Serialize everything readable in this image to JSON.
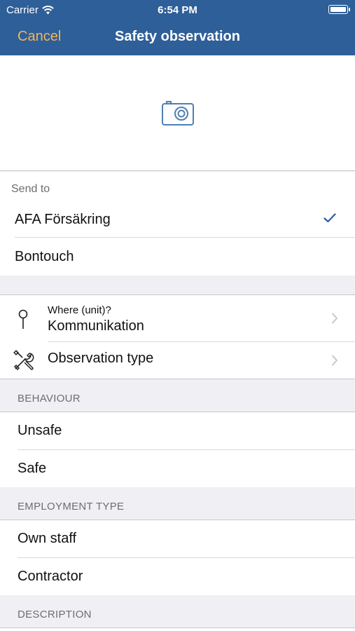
{
  "status": {
    "carrier": "Carrier",
    "time": "6:54 PM"
  },
  "nav": {
    "cancel": "Cancel",
    "title": "Safety observation"
  },
  "send_to": {
    "label": "Send to",
    "items": [
      {
        "label": "AFA Försäkring",
        "selected": true
      },
      {
        "label": "Bontouch",
        "selected": false
      }
    ]
  },
  "where": {
    "label": "Where (unit)?",
    "value": "Kommunikation"
  },
  "observation_type": {
    "label": "Observation type"
  },
  "behaviour": {
    "header": "BEHAVIOUR",
    "options": [
      "Unsafe",
      "Safe"
    ]
  },
  "employment": {
    "header": "EMPLOYMENT TYPE",
    "options": [
      "Own staff",
      "Contractor"
    ]
  },
  "description": {
    "header": "DESCRIPTION"
  },
  "colors": {
    "navbar": "#2f5f98",
    "cancel": "#f0b55c",
    "check": "#2f5f98",
    "icon": "#4f7fb3"
  },
  "icons": [
    "wifi-icon",
    "battery-icon",
    "camera-icon",
    "checkmark-icon",
    "pin-icon",
    "tools-icon",
    "chevron-right-icon"
  ]
}
